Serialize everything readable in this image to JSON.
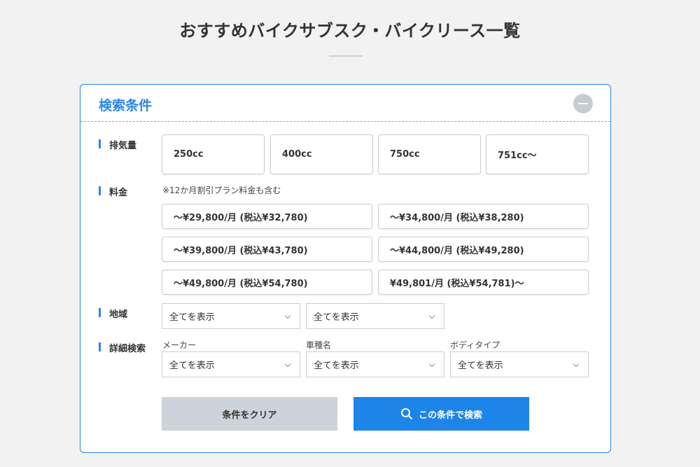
{
  "page": {
    "title": "おすすめバイクサブスク・バイクリース一覧"
  },
  "panel": {
    "title": "検索条件",
    "collapse_icon": "minus-icon"
  },
  "displacement": {
    "label": "排気量",
    "options": [
      "250cc",
      "400cc",
      "750cc",
      "751cc〜"
    ]
  },
  "price": {
    "label": "料金",
    "note": "※12か月割引プラン料金も含む",
    "options": [
      "〜¥29,800/月 (税込¥32,780)",
      "〜¥34,800/月 (税込¥38,280)",
      "〜¥39,800/月 (税込¥43,780)",
      "〜¥44,800/月 (税込¥49,280)",
      "〜¥49,800/月 (税込¥54,780)",
      "¥49,801/月 (税込¥54,781)〜"
    ]
  },
  "region": {
    "label": "地域",
    "selects": [
      "全てを表示",
      "全てを表示"
    ]
  },
  "detail": {
    "label": "詳細検索",
    "maker": {
      "label": "メーカー",
      "value": "全てを表示"
    },
    "model": {
      "label": "車種名",
      "value": "全てを表示"
    },
    "body": {
      "label": "ボディタイプ",
      "value": "全てを表示"
    }
  },
  "actions": {
    "clear_label": "条件をクリア",
    "search_label": "この条件で検索",
    "search_icon": "search-icon"
  },
  "colors": {
    "accent": "#2b86e8",
    "button_primary": "#1d84e8",
    "button_secondary": "#cdd3da"
  }
}
